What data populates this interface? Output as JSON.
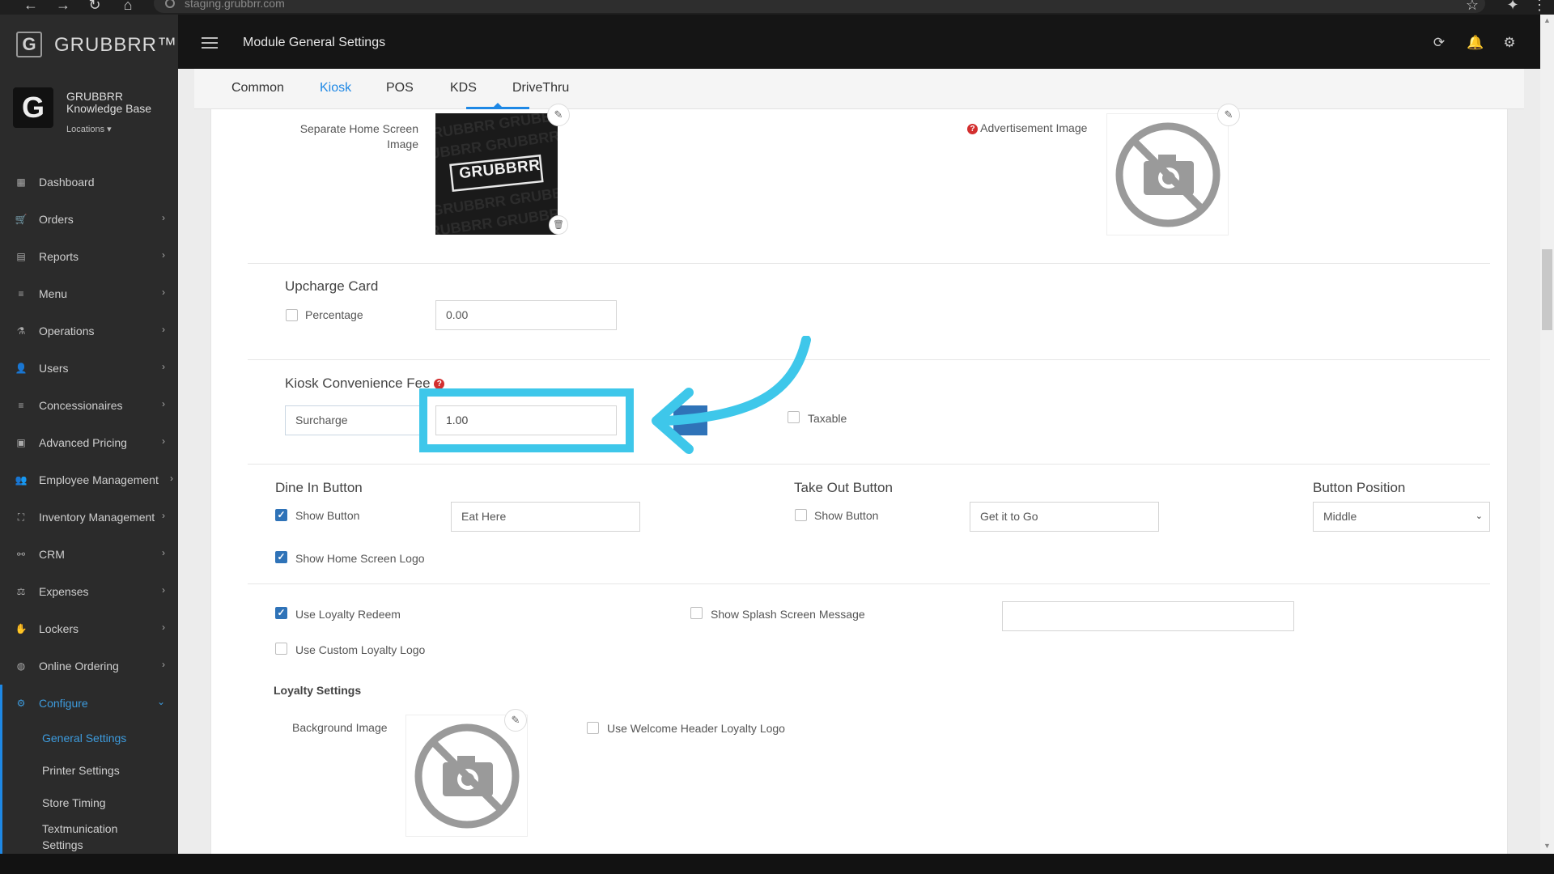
{
  "browser": {
    "url": "staging.grubbrr.com"
  },
  "header": {
    "brand": "GRUBBRR™",
    "page_title": "Module General Settings"
  },
  "profile": {
    "name": "GRUBBRR Knowledge Base",
    "locations_label": "Locations"
  },
  "sidebar": {
    "items": [
      {
        "label": "Dashboard",
        "icon": "dashboard-icon"
      },
      {
        "label": "Orders",
        "icon": "cart-icon"
      },
      {
        "label": "Reports",
        "icon": "report-icon"
      },
      {
        "label": "Menu",
        "icon": "list-icon"
      },
      {
        "label": "Operations",
        "icon": "flask-icon"
      },
      {
        "label": "Users",
        "icon": "users-icon"
      },
      {
        "label": "Concessionaires",
        "icon": "list-icon"
      },
      {
        "label": "Advanced Pricing",
        "icon": "money-icon"
      },
      {
        "label": "Employee Management",
        "icon": "group-icon"
      },
      {
        "label": "Inventory Management",
        "icon": "sitemap-icon"
      },
      {
        "label": "CRM",
        "icon": "link-icon"
      },
      {
        "label": "Expenses",
        "icon": "scale-icon"
      },
      {
        "label": "Lockers",
        "icon": "hand-icon"
      },
      {
        "label": "Online Ordering",
        "icon": "globe-icon"
      },
      {
        "label": "Configure",
        "icon": "gear-icon"
      }
    ],
    "sub_items": [
      "General Settings",
      "Printer Settings",
      "Store Timing",
      "Textmunication Settings"
    ]
  },
  "tabs": [
    "Common",
    "Kiosk",
    "POS",
    "KDS",
    "DriveThru"
  ],
  "active_tab": "Kiosk",
  "images": {
    "separate_home_label": "Separate Home Screen Image",
    "home_image_text": "GRUBBRR",
    "advertisement_label": "Advertisement Image",
    "help_glyph": "?"
  },
  "upcharge": {
    "title": "Upcharge Card",
    "percentage_label": "Percentage",
    "value": "0.00"
  },
  "convenience": {
    "title": "Kiosk Convenience Fee",
    "type": "Surcharge",
    "value": "1.00",
    "taxable_label": "Taxable"
  },
  "dine_in": {
    "title": "Dine In Button",
    "show_label": "Show Button",
    "value": "Eat Here",
    "home_logo_label": "Show Home Screen Logo"
  },
  "take_out": {
    "title": "Take Out Button",
    "show_label": "Show Button",
    "value": "Get it to Go"
  },
  "button_position": {
    "title": "Button Position",
    "value": "Middle"
  },
  "loyalty": {
    "redeem_label": "Use Loyalty Redeem",
    "custom_logo_label": "Use Custom Loyalty Logo",
    "splash_label": "Show Splash Screen Message",
    "splash_value": "",
    "settings_title": "Loyalty Settings",
    "background_label": "Background Image",
    "welcome_logo_label": "Use Welcome Header Loyalty Logo"
  },
  "colors": {
    "accent": "#1e88e5",
    "highlight": "#3ec7ea",
    "sidebar_bg": "#2b2b2b",
    "header_bg": "#151515",
    "checkbox": "#2f73b8"
  }
}
